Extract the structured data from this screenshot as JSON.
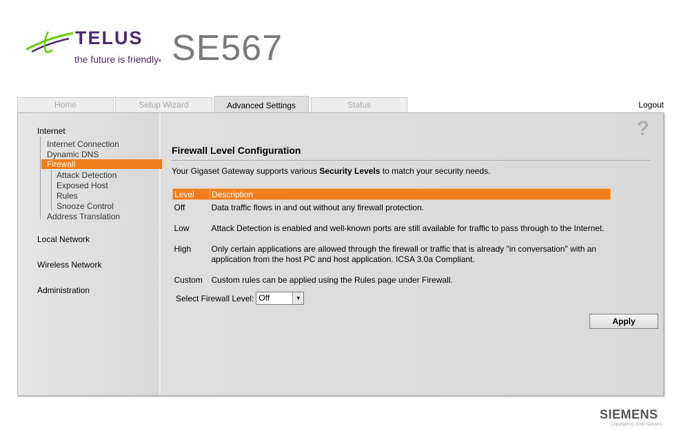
{
  "header": {
    "brand": "TELUS",
    "tagline": "the future is friendly",
    "tagline_mark": "•",
    "model": "SE567",
    "brand_color": "#4b286d",
    "leaf_color": "#66cc00"
  },
  "tabs": [
    {
      "label": "Home"
    },
    {
      "label": "Setup Wizard"
    },
    {
      "label": "Advanced Settings",
      "active": true
    },
    {
      "label": "Status"
    }
  ],
  "logout_label": "Logout",
  "sidebar": {
    "sections": [
      {
        "label": "Internet"
      },
      {
        "label": "Local Network"
      },
      {
        "label": "Wireless Network"
      },
      {
        "label": "Administration"
      }
    ],
    "internet_items": [
      {
        "label": "Internet Connection"
      },
      {
        "label": "Dynamic DNS"
      },
      {
        "label": "Firewall",
        "selected": true
      },
      {
        "label": "Address Translation"
      }
    ],
    "firewall_items": [
      {
        "label": "Attack Detection"
      },
      {
        "label": "Exposed Host"
      },
      {
        "label": "Rules"
      },
      {
        "label": "Snooze Control"
      }
    ],
    "accent_color": "#f07e1c"
  },
  "content": {
    "help_icon": "question-mark-icon",
    "help_glyph": "?",
    "title": "Firewall Level Configuration",
    "intro_prefix": "Your Gigaset Gateway supports various ",
    "intro_bold": "Security Levels",
    "intro_suffix": " to match your security needs.",
    "table": {
      "headers": [
        "Level",
        "Description"
      ],
      "rows": [
        {
          "level": "Off",
          "description": "Data traffic flows in and out without any firewall protection."
        },
        {
          "level": "Low",
          "description": "Attack Detection is enabled and well-known ports are still available for traffic to pass through to the Internet."
        },
        {
          "level": "High",
          "description": "Only certain applications are allowed through the firewall or traffic that is already \"in conversation\" with an application from the host PC and host application. ICSA 3.0a Compliant."
        },
        {
          "level": "Custom",
          "description": "Custom rules can be applied using the Rules page under Firewall."
        }
      ]
    },
    "select_label": "Select Firewall Level:",
    "select_value": "Off",
    "select_arrow_icon": "chevron-down-icon",
    "apply_label": "Apply"
  },
  "footer": {
    "brand": "SIEMENS",
    "copyright": "Copyright (c) 2005 Siemens"
  }
}
